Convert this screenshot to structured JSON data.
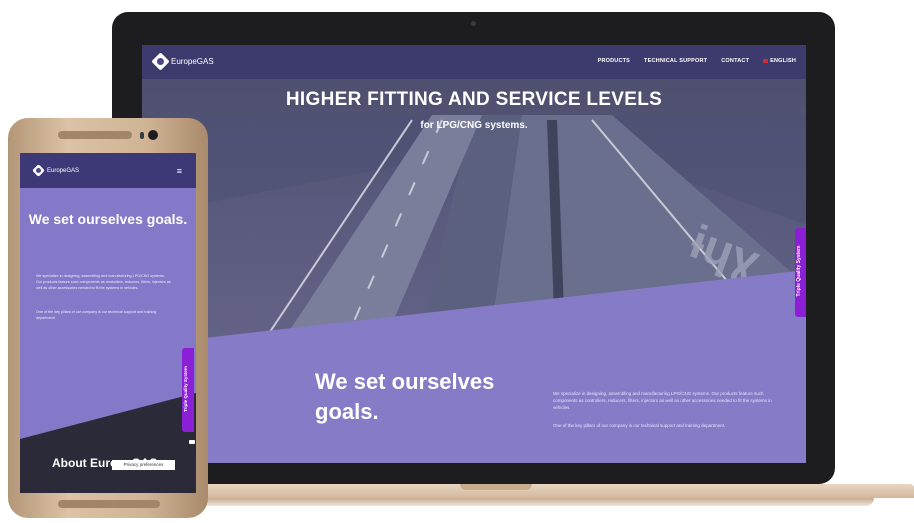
{
  "site": {
    "brand": "EuropeGAS",
    "nav": {
      "products": "PRODUCTS",
      "technical_support": "TECHNICAL SUPPORT",
      "contact": "CONTACT",
      "language": "ENGLISH",
      "menu_icon": "hamburger-icon"
    },
    "hero": {
      "title": "HIGHER FITTING AND SERVICE LEVELS",
      "subtitle": "for LPG/CNG systems."
    },
    "side_tab": "Triple Quality System",
    "goals_heading": "We set ourselves goals.",
    "paragraph1": "We specialize in designing, assembling and manufacturing LPG/CNG systems. Our products feature such components as controllers, reducers, filters, injectors as well as other accessories needed to fit the systems in vehicles.",
    "paragraph2": "One of the key pillars of our company is our technical support and training department.",
    "about_heading": "About EuropeGAS",
    "privacy_badge": "Privacy preferences"
  },
  "colors": {
    "accent_purple": "#8a1fd6",
    "section_purple": "#857bc6",
    "nav_purple": "#3d3876"
  }
}
